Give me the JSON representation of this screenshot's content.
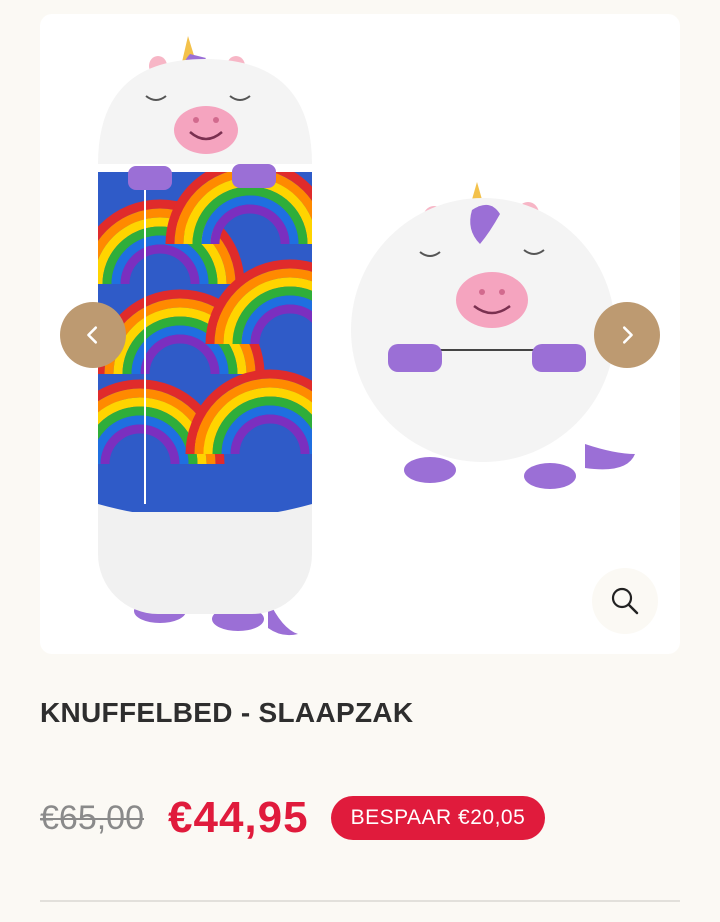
{
  "product": {
    "title": "KNUFFELBED - SLAAPZAK",
    "old_price": "€65,00",
    "new_price": "€44,95",
    "save_label": "BESPAAR €20,05"
  },
  "colors": {
    "accent_brown": "#bd9a71",
    "sale_red": "#e01b3c",
    "background": "#fbf9f4"
  },
  "gallery": {
    "image_alt": "Unicorn sleeping bag product image",
    "prev_icon": "chevron-left-icon",
    "next_icon": "chevron-right-icon",
    "zoom_icon": "search-icon"
  }
}
